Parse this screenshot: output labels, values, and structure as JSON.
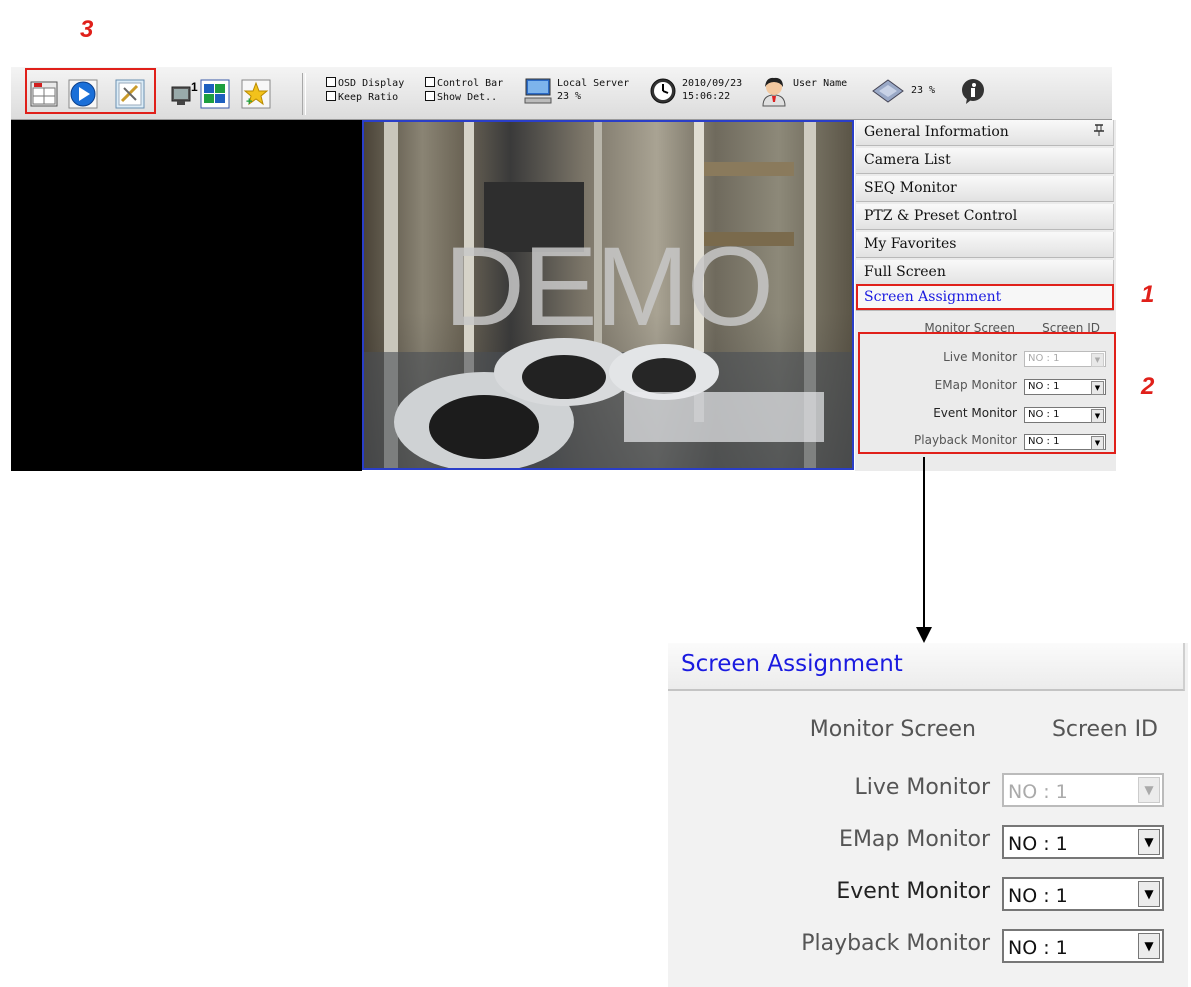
{
  "callouts": {
    "one": "1",
    "two": "2",
    "three": "3"
  },
  "toolbar": {
    "icons": [
      "live-view-icon",
      "playback-icon",
      "settings-icon",
      "single-screen-icon",
      "multi-screen-icon",
      "favorites-star-icon"
    ],
    "checkboxes": {
      "osd_display": "OSD Display",
      "keep_ratio": "Keep Ratio",
      "control_bar": "Control Bar",
      "show_details": "Show Det.."
    },
    "server": {
      "name": "Local Server",
      "usage": "23 %"
    },
    "datetime": {
      "date": "2010/09/23",
      "time": "15:06:22"
    },
    "user": {
      "name": "User Name"
    },
    "cpu": {
      "usage": "23 %"
    },
    "info_icon": "info-icon"
  },
  "video": {
    "watermark": "DEMO"
  },
  "panel": {
    "menu": [
      {
        "label": "General Information"
      },
      {
        "label": "Camera List"
      },
      {
        "label": "SEQ Monitor"
      },
      {
        "label": "PTZ & Preset Control"
      },
      {
        "label": "My Favorites"
      },
      {
        "label": "Full Screen"
      },
      {
        "label": "Screen Assignment"
      }
    ],
    "pin_icon": "pin-icon",
    "assignment": {
      "col_monitor": "Monitor Screen",
      "col_screen": "Screen ID",
      "rows": [
        {
          "label": "Live Monitor",
          "value": "NO : 1",
          "disabled": true
        },
        {
          "label": "EMap Monitor",
          "value": "NO : 1",
          "disabled": false
        },
        {
          "label": "Event Monitor",
          "value": "NO : 1",
          "disabled": false
        },
        {
          "label": "Playback Monitor",
          "value": "NO : 1",
          "disabled": false
        }
      ]
    }
  },
  "colors": {
    "accent_blue": "#1a1ae0",
    "highlight_red": "#e0201a",
    "video_border": "#2a3ec8"
  }
}
